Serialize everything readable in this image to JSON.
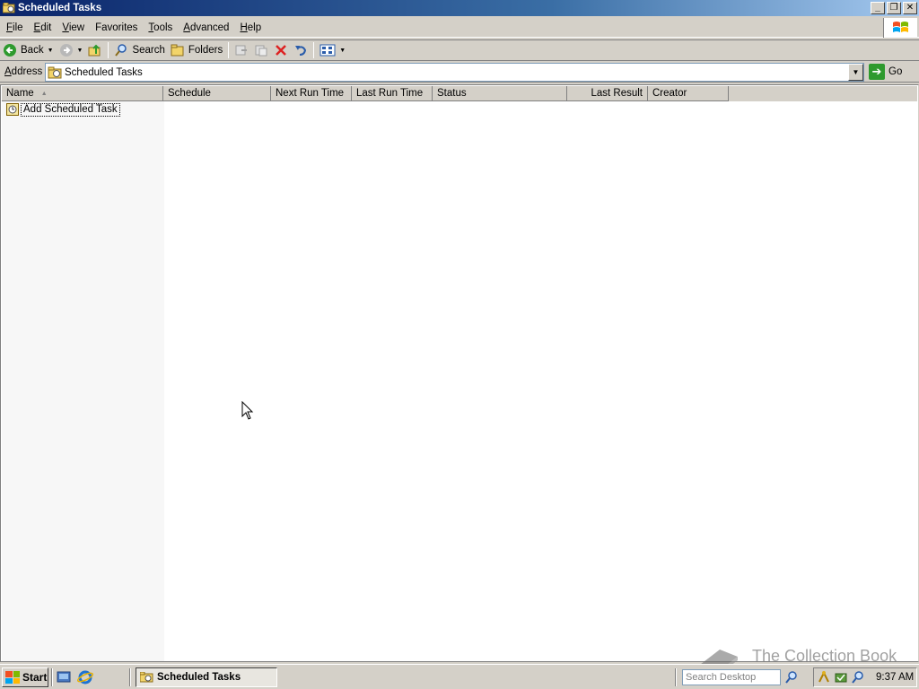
{
  "window": {
    "title": "Scheduled Tasks"
  },
  "menu": [
    {
      "ul": "F",
      "rest": "ile"
    },
    {
      "ul": "E",
      "rest": "dit"
    },
    {
      "ul": "V",
      "rest": "iew"
    },
    {
      "ul": "F",
      "rest": "avorites",
      "ul_index": 1
    },
    {
      "ul": "T",
      "rest": "ools"
    },
    {
      "ul": "A",
      "rest": "dvanced"
    },
    {
      "ul": "H",
      "rest": "elp"
    }
  ],
  "toolbar": {
    "back": "Back",
    "search": "Search",
    "folders": "Folders"
  },
  "address": {
    "label_ul": "A",
    "label_rest": "ddress",
    "value": "Scheduled Tasks",
    "go": "Go"
  },
  "columns": [
    "Name",
    "Schedule",
    "Next Run Time",
    "Last Run Time",
    "Status",
    "Last Result",
    "Creator"
  ],
  "rows": [
    {
      "name": "Add Scheduled Task"
    }
  ],
  "taskbar": {
    "start": "Start",
    "active_task": "Scheduled Tasks",
    "search_placeholder": "Search Desktop",
    "clock": "9:37 AM"
  },
  "watermark": "The Collection Book",
  "colors": {
    "titlebar_start": "#0a246a",
    "titlebar_end": "#a6caf0",
    "chrome": "#d4d0c8"
  }
}
